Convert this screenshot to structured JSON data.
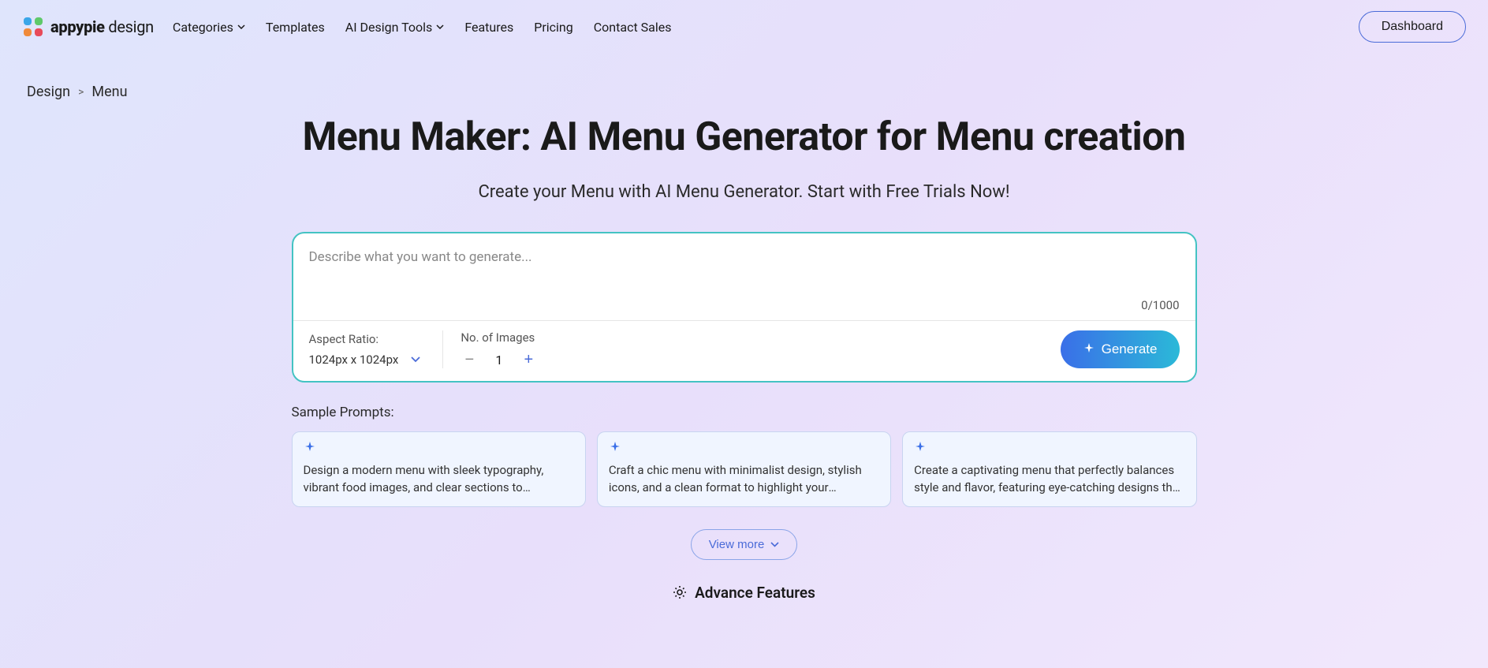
{
  "header": {
    "logo_bold": "appypie",
    "logo_light": " design",
    "nav": {
      "categories": "Categories",
      "templates": "Templates",
      "ai_tools": "AI Design Tools",
      "features": "Features",
      "pricing": "Pricing",
      "contact": "Contact Sales"
    },
    "dashboard": "Dashboard"
  },
  "breadcrumb": {
    "root": "Design",
    "current": "Menu"
  },
  "hero": {
    "title": "Menu Maker: AI Menu Generator for Menu creation",
    "subtitle": "Create your Menu with AI Menu Generator. Start with Free Trials Now!"
  },
  "generator": {
    "placeholder": "Describe what you want to generate...",
    "char_count": "0/1000",
    "aspect_label": "Aspect Ratio:",
    "aspect_value": "1024px x 1024px",
    "num_label": "No. of Images",
    "num_value": "1",
    "generate_label": "Generate"
  },
  "samples": {
    "label": "Sample Prompts:",
    "items": [
      "Design a modern menu with sleek typography, vibrant food images, and clear sections to showcase your…",
      "Craft a chic menu with minimalist design, stylish icons, and a clean format to highlight your restaurant's…",
      "Create a captivating menu that perfectly balances style and flavor, featuring eye-catching designs that bring…"
    ],
    "viewmore": "View more"
  },
  "advance": "Advance Features"
}
